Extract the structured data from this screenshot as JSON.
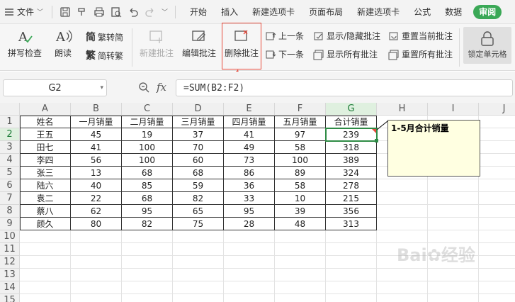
{
  "menubar": {
    "file_label": "文件",
    "tabs": [
      "开始",
      "插入",
      "新建选项卡",
      "页面布局",
      "新建选项卡",
      "公式",
      "数据"
    ],
    "active_tab": "审阅"
  },
  "ribbon": {
    "spellcheck": "拼写检查",
    "read": "朗读",
    "trad_simp": "繁转简",
    "simp_trad": "简转繁",
    "new_comment": "新建批注",
    "edit_comment": "编辑批注",
    "delete_comment": "删除批注",
    "prev": "上一条",
    "next": "下一条",
    "show_hide": "显示/隐藏批注",
    "show_all": "显示所有批注",
    "reset_current": "重置当前批注",
    "reset_all": "重置所有批注",
    "lock_cell": "锁定单元格"
  },
  "formula_bar": {
    "name_box": "G2",
    "formula": "=SUM(B2:F2)"
  },
  "sheet": {
    "columns": [
      "A",
      "B",
      "C",
      "D",
      "E",
      "F",
      "G",
      "H",
      "I",
      "J"
    ],
    "rows": [
      "1",
      "2",
      "3",
      "4",
      "5",
      "6",
      "7",
      "8",
      "9",
      "10",
      "11",
      "12",
      "13",
      "14",
      "15"
    ],
    "headers": [
      "姓名",
      "一月销量",
      "二月销量",
      "三月销量",
      "四月销量",
      "五月销量",
      "合计销量"
    ],
    "data": [
      [
        "王五",
        "45",
        "19",
        "37",
        "41",
        "97",
        "239"
      ],
      [
        "田七",
        "41",
        "100",
        "70",
        "49",
        "58",
        "318"
      ],
      [
        "李四",
        "56",
        "100",
        "60",
        "73",
        "100",
        "389"
      ],
      [
        "张三",
        "13",
        "68",
        "68",
        "86",
        "89",
        "324"
      ],
      [
        "陆六",
        "40",
        "85",
        "59",
        "36",
        "58",
        "278"
      ],
      [
        "袁二",
        "22",
        "68",
        "82",
        "33",
        "10",
        "215"
      ],
      [
        "蔡八",
        "62",
        "95",
        "65",
        "95",
        "39",
        "356"
      ],
      [
        "颜久",
        "80",
        "82",
        "75",
        "28",
        "48",
        "313"
      ]
    ],
    "comment": "1-5月合计销量",
    "selected_cell": "G2"
  },
  "colors": {
    "accent": "#3aa856",
    "selection": "#2e8b45",
    "comment_bg": "#ffffe1",
    "highlight": "#e84b3c"
  }
}
